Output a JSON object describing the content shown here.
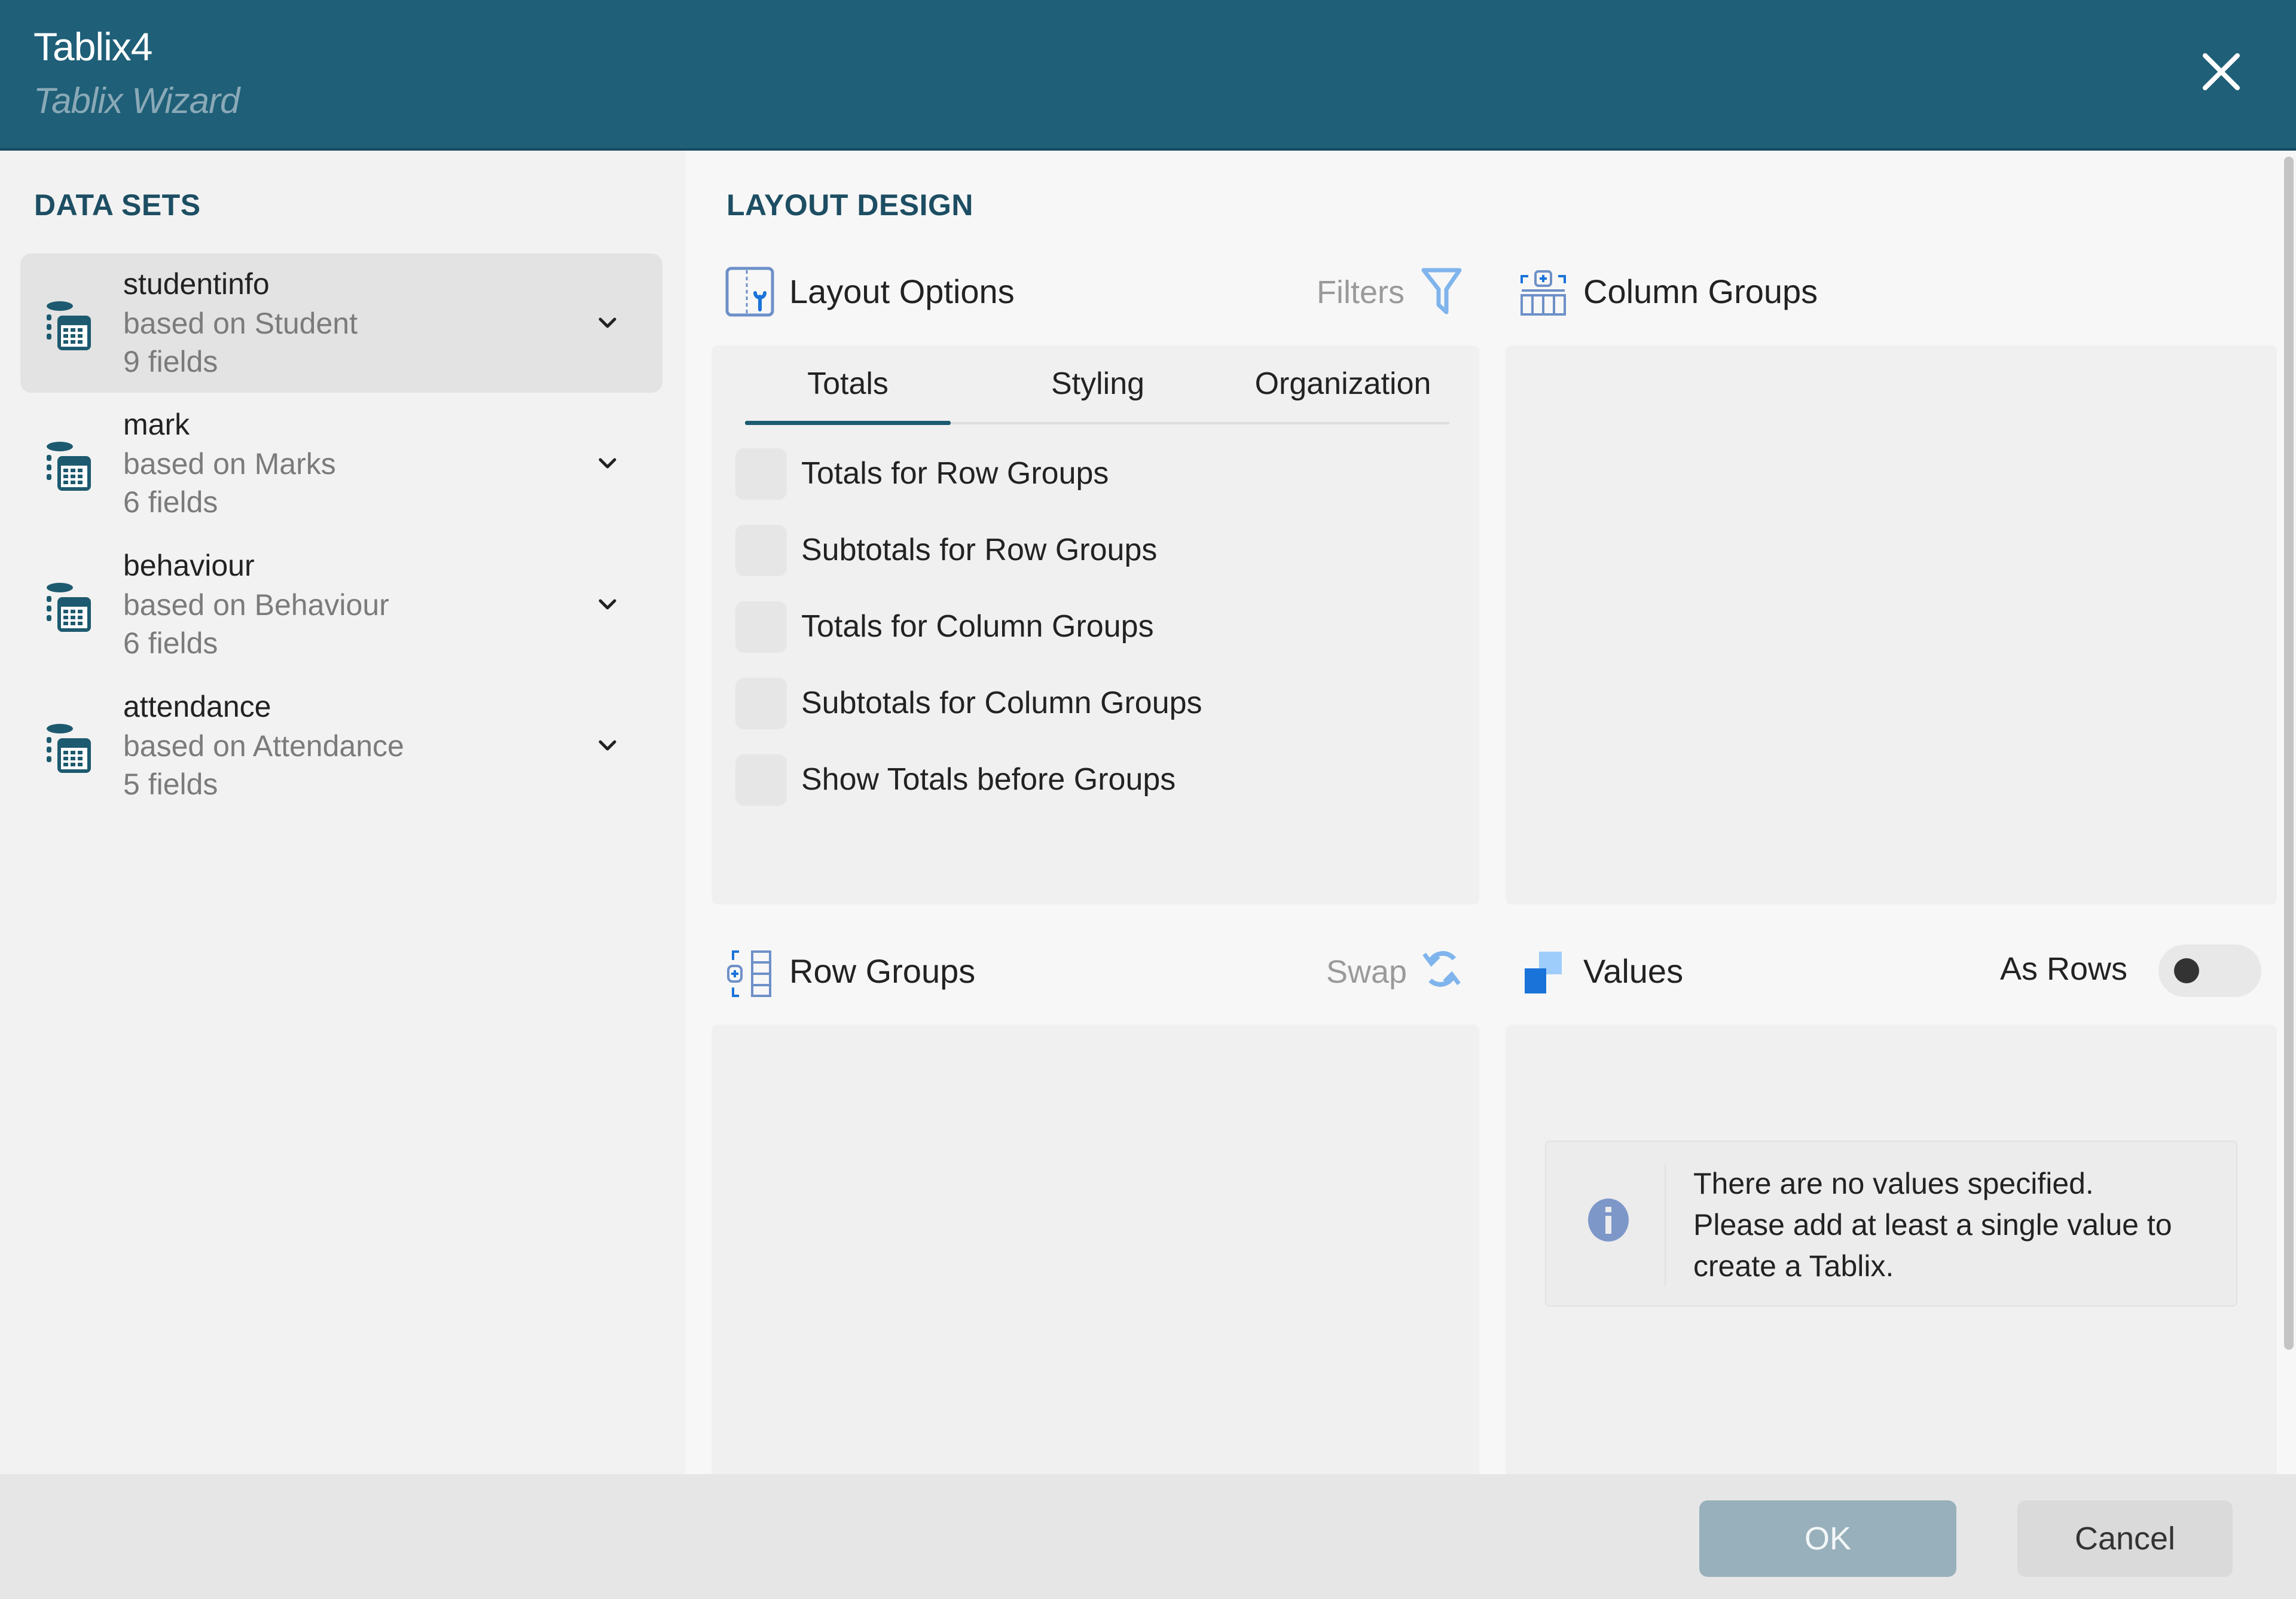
{
  "window": {
    "title": "Tablix4",
    "subtitle": "Tablix Wizard",
    "close_icon": "close-icon"
  },
  "sidebar": {
    "heading": "DATA SETS",
    "items": [
      {
        "name": "studentinfo",
        "based_on": "based on Student",
        "fields": "9 fields",
        "selected": true,
        "icon": "database-table-icon"
      },
      {
        "name": "mark",
        "based_on": "based on Marks",
        "fields": "6 fields",
        "selected": false,
        "icon": "database-table-icon"
      },
      {
        "name": "behaviour",
        "based_on": "based on Behaviour",
        "fields": "6 fields",
        "selected": false,
        "icon": "database-table-icon"
      },
      {
        "name": "attendance",
        "based_on": "based on Attendance",
        "fields": "5 fields",
        "selected": false,
        "icon": "database-table-icon"
      }
    ]
  },
  "main": {
    "heading": "LAYOUT DESIGN",
    "layout_options": {
      "label": "Layout Options",
      "icon": "layout-options-icon",
      "filters_label": "Filters",
      "filters_icon": "filter-icon",
      "tabs": [
        {
          "label": "Totals",
          "active": true
        },
        {
          "label": "Styling",
          "active": false
        },
        {
          "label": "Organization",
          "active": false
        }
      ],
      "checkboxes": [
        {
          "label": "Totals for Row Groups",
          "checked": false
        },
        {
          "label": "Subtotals for Row Groups",
          "checked": false
        },
        {
          "label": "Totals for Column Groups",
          "checked": false
        },
        {
          "label": "Subtotals for Column Groups",
          "checked": false
        },
        {
          "label": "Show Totals before Groups",
          "checked": false
        }
      ]
    },
    "column_groups": {
      "label": "Column Groups",
      "icon": "column-groups-icon"
    },
    "row_groups": {
      "label": "Row Groups",
      "icon": "row-groups-icon",
      "swap_label": "Swap",
      "swap_icon": "swap-icon"
    },
    "values": {
      "label": "Values",
      "icon": "values-icon",
      "as_rows_label": "As Rows",
      "as_rows_on": false,
      "info_icon": "info-icon",
      "info_lines": [
        "There are no values specified.",
        "Please add at least a single value to",
        "create a Tablix."
      ]
    }
  },
  "footer": {
    "ok_label": "OK",
    "cancel_label": "Cancel"
  },
  "colors": {
    "header_bg": "#1f5f78",
    "accent": "#1b5a70",
    "icon_blue": "#1a73d9",
    "ok_disabled": "#98b0bb"
  }
}
